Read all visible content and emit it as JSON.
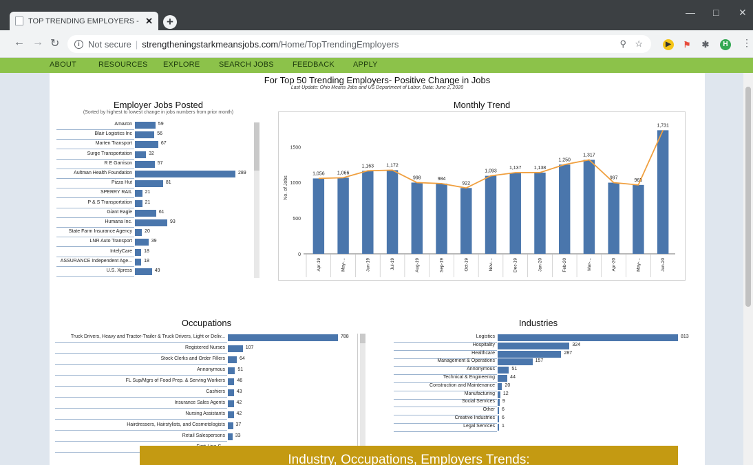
{
  "browser": {
    "tab_title": "TOP TRENDING EMPLOYERS - St",
    "tab_close": "✕",
    "new_tab": "+",
    "security_label": "Not secure",
    "url_domain": "strengtheningstarkmeansjobs.com",
    "url_path": "/Home/TopTrendingEmployers",
    "profile_initial": "H"
  },
  "sitenav": [
    "ABOUT",
    "RESOURCES",
    "EXPLORE",
    "SEARCH JOBS",
    "FEEDBACK",
    "APPLY"
  ],
  "report": {
    "title": "For Top 50 Trending Employers- Positive Change in Jobs",
    "subtitle": "Last Update: Ohio Means Jobs and US Department of Labor, Data: June 2, 2020"
  },
  "employers": {
    "title": "Employer Jobs Posted",
    "subtitle": "(Sorted by highest to lowest change in jobs  numbers from prior month)"
  },
  "trend": {
    "title": "Monthly Trend"
  },
  "occupations": {
    "title": "Occupations"
  },
  "industries": {
    "title": "Industries"
  },
  "banner": {
    "text": "Industry, Occupations, Employers Trends:"
  },
  "chart_data": [
    {
      "type": "bar",
      "title": "Employer Jobs Posted",
      "orientation": "horizontal",
      "categories": [
        "Amazon",
        "Blair Logistics Inc",
        "Marten Transport",
        "Surge Transportation",
        "R E Garrison",
        "Aultman Health Foundation",
        "Pizza Hut",
        "SPERRY RAIL",
        "P & S Transportation",
        "Giant Eagle",
        "Humana Inc.",
        "State Farm Insurance Agency",
        "LNR Auto Transport",
        "IntelyCare",
        "ASSURANCE Independent Age...",
        "U.S. Xpress"
      ],
      "values": [
        59,
        56,
        67,
        32,
        57,
        289,
        81,
        21,
        21,
        61,
        93,
        20,
        39,
        18,
        18,
        49
      ]
    },
    {
      "type": "bar",
      "title": "Monthly Trend",
      "ylabel": "No. of Jobs",
      "categories": [
        "Apr-19",
        "May-...",
        "Jun-19",
        "Jul-19",
        "Aug-19",
        "Sep-19",
        "Oct-19",
        "Nov-...",
        "Dec-19",
        "Jan-20",
        "Feb-20",
        "Mar-...",
        "Apr-20",
        "May-...",
        "Jun-20"
      ],
      "values": [
        1056,
        1066,
        1163,
        1172,
        998,
        984,
        922,
        1093,
        1137,
        1138,
        1250,
        1317,
        997,
        965,
        1731
      ],
      "value_labels": [
        "1,056",
        "1,066",
        "1,163",
        "1,172",
        "998",
        "984",
        "922",
        "1,093",
        "1,137",
        "1,138",
        "1,250",
        "1,317",
        "997",
        "965",
        "1,731"
      ],
      "yticks": [
        0,
        500,
        1000,
        1500
      ],
      "ylim": [
        0,
        1850
      ],
      "line_overlay": true
    },
    {
      "type": "bar",
      "title": "Occupations",
      "orientation": "horizontal",
      "categories": [
        "Truck Drivers, Heavy and Tractor-Trailer & Truck Drivers, Light or Deliv...",
        "Registered Nurses",
        "Stock Clerks and Order Fillers",
        "Annonymous",
        "FL Sup/Mgrs of Food Prep. & Serving Workers",
        "Cashiers",
        "Insurance Sales Agents",
        "Nursing Assistants",
        "Hairdressers, Hairstylists, and Cosmetologists",
        "Retail Salespersons",
        "First-Line S..."
      ],
      "values": [
        788,
        107,
        64,
        51,
        46,
        43,
        42,
        42,
        37,
        33,
        null
      ]
    },
    {
      "type": "bar",
      "title": "Industries",
      "orientation": "horizontal",
      "categories": [
        "Logistics",
        "Hospitality",
        "Healthcare",
        "Management & Operations",
        "Annonymous",
        "Technical & Engineering",
        "Construction and Maintenance",
        "Manufacturing",
        "Social Services",
        "Other",
        "Creative Industries",
        "Legal Services"
      ],
      "values": [
        813,
        324,
        287,
        157,
        51,
        44,
        20,
        12,
        9,
        6,
        6,
        1
      ]
    }
  ],
  "colors": {
    "bar": "#4a76ac",
    "trend_line": "#f0a040",
    "nav_green": "#8cc24a",
    "banner": "#c49a12"
  }
}
